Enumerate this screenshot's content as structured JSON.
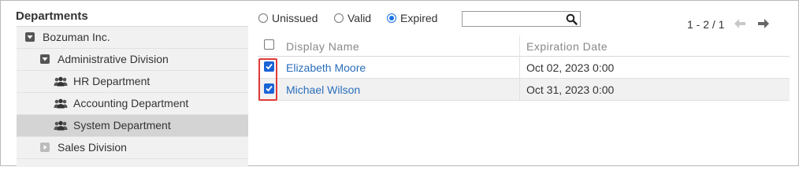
{
  "left_panel": {
    "title": "Departments",
    "tree": [
      {
        "label": "Bozuman Inc.",
        "level": 0,
        "icon": "collapse-square-icon",
        "selected": false
      },
      {
        "label": "Administrative Division",
        "level": 1,
        "icon": "collapse-square-icon",
        "selected": false
      },
      {
        "label": "HR Department",
        "level": 2,
        "icon": "group-icon",
        "selected": false
      },
      {
        "label": "Accounting Department",
        "level": 2,
        "icon": "group-icon",
        "selected": false
      },
      {
        "label": "System Department",
        "level": 2,
        "icon": "group-icon",
        "selected": true
      },
      {
        "label": "Sales Division",
        "level": 1,
        "icon": "expand-square-icon",
        "selected": false
      }
    ]
  },
  "filter": {
    "options": [
      {
        "label": "Unissued",
        "checked": false
      },
      {
        "label": "Valid",
        "checked": false
      },
      {
        "label": "Expired",
        "checked": true
      }
    ]
  },
  "search": {
    "value": "",
    "icon": "search-icon"
  },
  "pager": {
    "text": "1 - 2 / 1",
    "prev_icon": "arrow-left-icon",
    "next_icon": "arrow-right-icon"
  },
  "table": {
    "columns": [
      "Display Name",
      "Expiration Date"
    ],
    "select_all_checked": false,
    "rows": [
      {
        "name": "Elizabeth Moore",
        "date": "Oct 02, 2023 0:00",
        "checked": true
      },
      {
        "name": "Michael Wilson",
        "date": "Oct 31, 2023 0:00",
        "checked": true
      }
    ]
  },
  "colors": {
    "accent": "#1a64d6",
    "link": "#2a6ebb",
    "highlight": "#e03a3a",
    "selected_row": "#d4d4d4"
  }
}
